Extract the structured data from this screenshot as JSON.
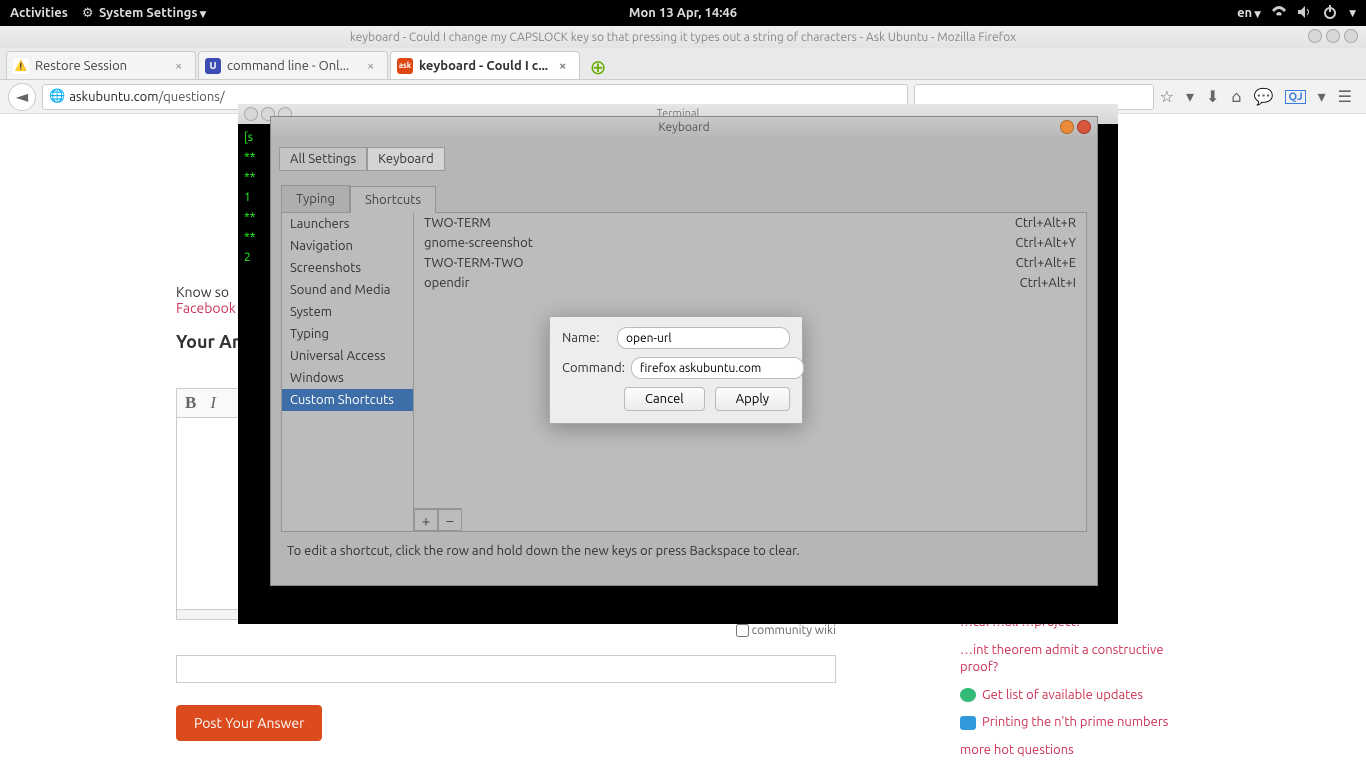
{
  "topbar": {
    "activities": "Activities",
    "appmenu": "System Settings",
    "clock": "Mon 13 Apr, 14:46",
    "lang": "en"
  },
  "firefox": {
    "window_title": "keyboard - Could I change my CAPSLOCK key so that pressing it types out a string of characters - Ask Ubuntu - Mozilla Firefox",
    "tabs": [
      {
        "label": "Restore Session"
      },
      {
        "label": "command line - Onl..."
      },
      {
        "label": "keyboard - Could I c..."
      }
    ],
    "url_host": "askubuntu.com",
    "url_path": "/questions/"
  },
  "terminal": {
    "title": "Terminal",
    "lines": [
      "[s",
      "**",
      "**",
      "1",
      "**",
      "**",
      "2"
    ]
  },
  "keyboard_window": {
    "title": "Keyboard",
    "breadcrumb": [
      "All Settings",
      "Keyboard"
    ],
    "tabs": [
      "Typing",
      "Shortcuts"
    ],
    "active_tab": "Shortcuts",
    "categories": [
      "Launchers",
      "Navigation",
      "Screenshots",
      "Sound and Media",
      "System",
      "Typing",
      "Universal Access",
      "Windows",
      "Custom Shortcuts"
    ],
    "selected_category": "Custom Shortcuts",
    "shortcuts": [
      {
        "name": "TWO-TERM",
        "accel": "Ctrl+Alt+R"
      },
      {
        "name": "gnome-screenshot",
        "accel": "Ctrl+Alt+Y"
      },
      {
        "name": "TWO-TERM-TWO",
        "accel": "Ctrl+Alt+E"
      },
      {
        "name": "opendir",
        "accel": "Ctrl+Alt+I"
      }
    ],
    "hint": "To edit a shortcut, click the row and hold down the new keys or press Backspace to clear."
  },
  "dialog": {
    "name_label": "Name:",
    "command_label": "Command:",
    "name_value": "open-url",
    "command_value": "firefox askubuntu.com",
    "cancel": "Cancel",
    "apply": "Apply"
  },
  "page": {
    "know": "Know so",
    "facebook": "Facebook",
    "your_answer": "Your An",
    "community_wiki": "community wiki",
    "post": "Post Your Answer",
    "sidebar_links": [
      "…cal …all …project?",
      "…int theorem admit a constructive proof?",
      "Get list of available updates",
      "Printing the n'th prime numbers",
      "more hot questions"
    ]
  }
}
